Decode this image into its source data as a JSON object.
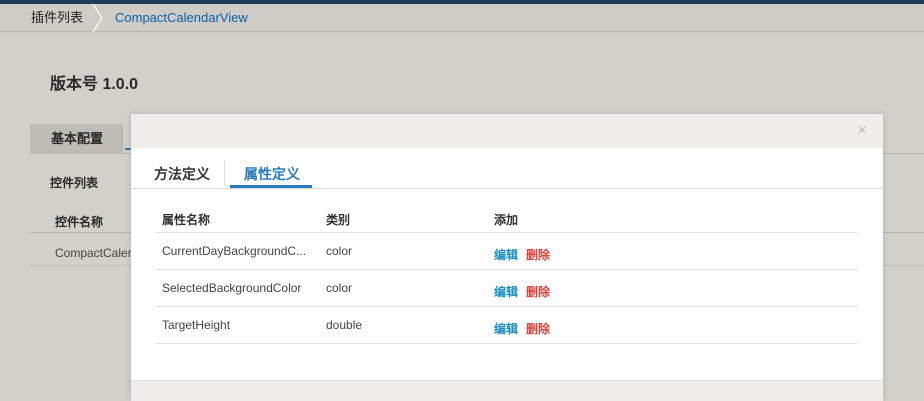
{
  "breadcrumb": {
    "home": "插件列表",
    "current": "CompactCalendarView"
  },
  "page": {
    "version_title": "版本号 1.0.0",
    "config_tab": "基本配置",
    "control_list_title": "控件列表",
    "control_table_header": "控件名称",
    "control_row_value": "CompactCaler"
  },
  "modal": {
    "close_glyph": "×",
    "tabs": [
      {
        "label": "方法定义",
        "active": false
      },
      {
        "label": "属性定义",
        "active": true
      }
    ],
    "table": {
      "headers": {
        "name": "属性名称",
        "type": "类别",
        "add": "添加"
      },
      "rows": [
        {
          "name": "CurrentDayBackgroundC...",
          "type": "color",
          "edit": "编辑",
          "delete": "删除"
        },
        {
          "name": "SelectedBackgroundColor",
          "type": "color",
          "edit": "编辑",
          "delete": "删除"
        },
        {
          "name": "TargetHeight",
          "type": "double",
          "edit": "编辑",
          "delete": "删除"
        }
      ]
    }
  },
  "colors": {
    "accent": "#2a7bbd",
    "link": "#1b8fc6",
    "danger": "#e0413b",
    "top_bar": "#1f3d5c"
  }
}
